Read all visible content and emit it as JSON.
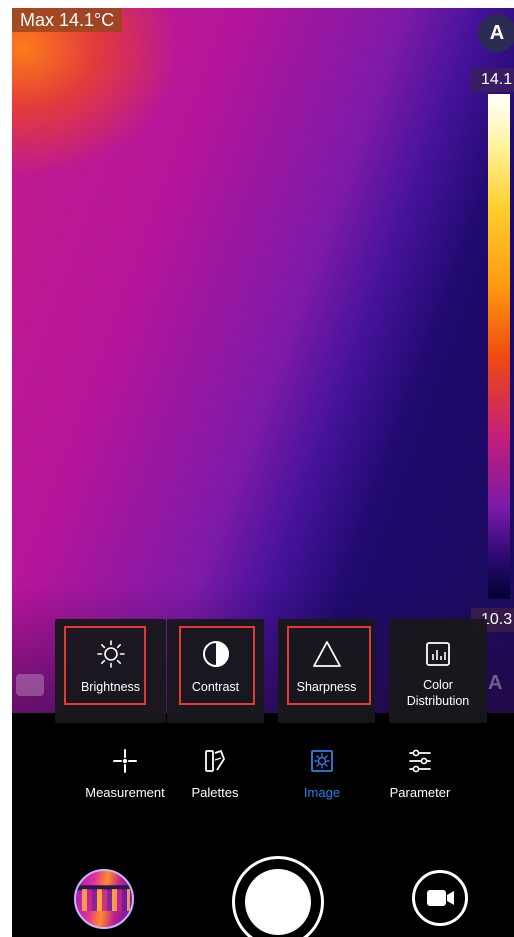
{
  "thermal": {
    "max_label": "Max  14.1°C",
    "auto_button": "A",
    "scale_max": "14.1",
    "scale_min": "10.3",
    "ghost_auto": "A"
  },
  "image_menu": {
    "items": [
      {
        "label": "Brightness",
        "icon": "brightness-icon",
        "highlighted": true
      },
      {
        "label": "Contrast",
        "icon": "contrast-icon",
        "highlighted": true
      },
      {
        "label": "Sharpness",
        "icon": "sharpness-icon",
        "highlighted": true
      },
      {
        "label": "Color\nDistribution",
        "icon": "color-distribution-icon",
        "highlighted": false
      }
    ],
    "highlight_color": "#e53935"
  },
  "tabs": [
    {
      "label": "Measurement",
      "icon": "crosshair-icon",
      "active": false
    },
    {
      "label": "Palettes",
      "icon": "palettes-icon",
      "active": false
    },
    {
      "label": "Image",
      "icon": "image-settings-icon",
      "active": true
    },
    {
      "label": "Parameter",
      "icon": "sliders-icon",
      "active": false
    }
  ],
  "colors": {
    "accent": "#2f7fe8",
    "background": "#000000"
  }
}
